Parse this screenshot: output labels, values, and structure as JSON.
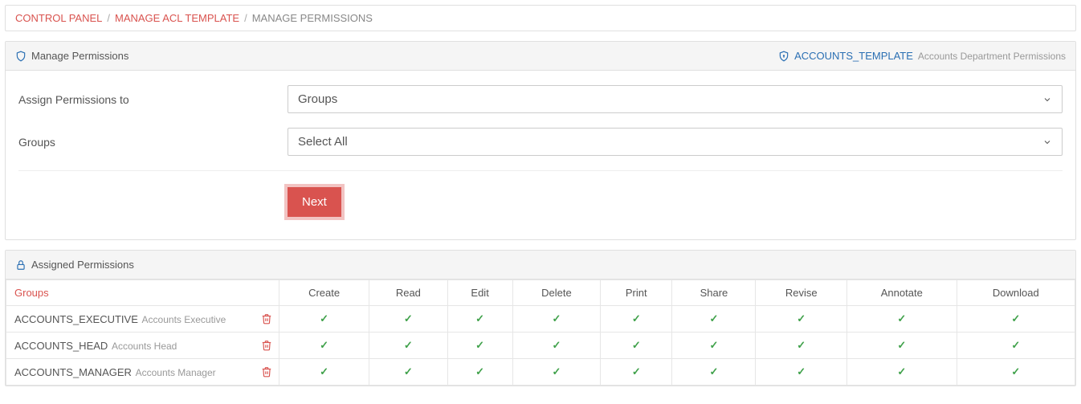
{
  "breadcrumb": {
    "items": [
      {
        "label": "CONTROL PANEL",
        "link": true
      },
      {
        "label": "MANAGE ACL TEMPLATE",
        "link": true
      },
      {
        "label": "MANAGE PERMISSIONS",
        "link": false
      }
    ],
    "sep": "/"
  },
  "manage_panel": {
    "title": "Manage Permissions",
    "template_code": "ACCOUNTS_TEMPLATE",
    "template_desc": "Accounts Department Permissions",
    "form": {
      "assign_label": "Assign Permissions to",
      "assign_value": "Groups",
      "groups_label": "Groups",
      "groups_value": "Select All",
      "next_label": "Next"
    }
  },
  "assigned_panel": {
    "title": "Assigned Permissions",
    "columns": [
      "Groups",
      "Create",
      "Read",
      "Edit",
      "Delete",
      "Print",
      "Share",
      "Revise",
      "Annotate",
      "Download"
    ],
    "rows": [
      {
        "code": "ACCOUNTS_EXECUTIVE",
        "desc": "Accounts Executive",
        "perms": [
          true,
          true,
          true,
          true,
          true,
          true,
          true,
          true,
          true
        ]
      },
      {
        "code": "ACCOUNTS_HEAD",
        "desc": "Accounts Head",
        "perms": [
          true,
          true,
          true,
          true,
          true,
          true,
          true,
          true,
          true
        ]
      },
      {
        "code": "ACCOUNTS_MANAGER",
        "desc": "Accounts Manager",
        "perms": [
          true,
          true,
          true,
          true,
          true,
          true,
          true,
          true,
          true
        ]
      }
    ]
  },
  "glyphs": {
    "check": "✓"
  }
}
